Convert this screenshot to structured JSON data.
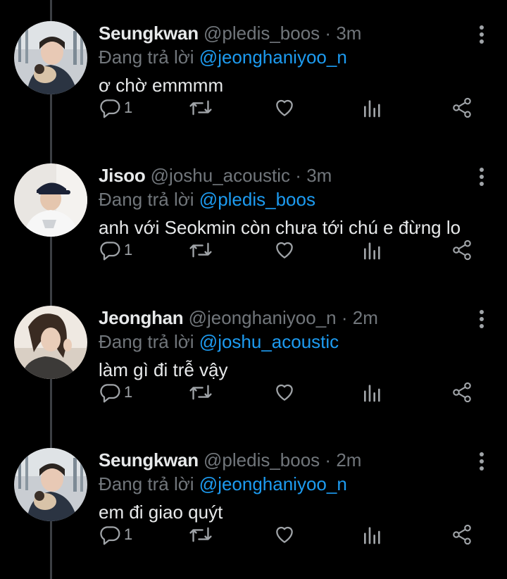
{
  "reply_prefix": "Đang trả lời",
  "tweets": [
    {
      "name": "Seungkwan",
      "handle": "@pledis_boos",
      "time": "3m",
      "reply_to": "@jeonghaniyoo_n",
      "text": "ơ chờ emmmm",
      "reply_count": "1"
    },
    {
      "name": "Jisoo",
      "handle": "@joshu_acoustic",
      "time": "3m",
      "reply_to": "@pledis_boos",
      "text": "anh với Seokmin còn chưa tới chú e đừng lo",
      "reply_count": "1"
    },
    {
      "name": "Jeonghan",
      "handle": "@jeonghaniyoo_n",
      "time": "2m",
      "reply_to": "@joshu_acoustic",
      "text": "làm gì đi trễ vậy",
      "reply_count": "1"
    },
    {
      "name": "Seungkwan",
      "handle": "@pledis_boos",
      "time": "2m",
      "reply_to": "@jeonghaniyoo_n",
      "text": "em đi giao quýt",
      "reply_count": "1"
    }
  ],
  "colors": {
    "background": "#000000",
    "text": "#e7e9ea",
    "muted": "#71767b",
    "mention": "#1d9bf0",
    "icon": "#a0a4a8"
  },
  "icons": [
    "reply-icon",
    "retweet-icon",
    "like-icon",
    "views-icon",
    "share-icon",
    "more-icon"
  ]
}
